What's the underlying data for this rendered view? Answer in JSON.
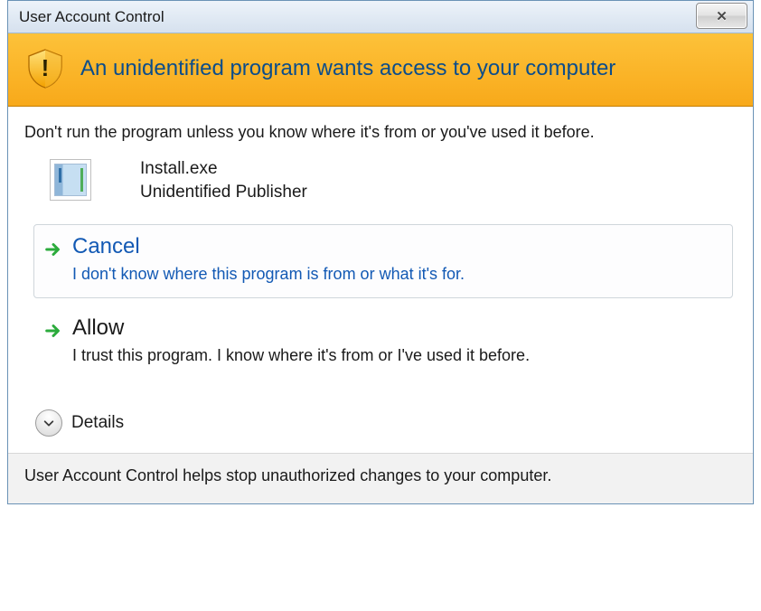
{
  "titlebar": {
    "title": "User Account Control"
  },
  "banner": {
    "heading": "An unidentified program wants access to your computer"
  },
  "instruction": "Don't run the program unless you know where it's from or you've used it before.",
  "program": {
    "filename": "Install.exe",
    "publisher": "Unidentified Publisher"
  },
  "options": {
    "cancel": {
      "title": "Cancel",
      "description": "I don't know where this program is from or what it's for."
    },
    "allow": {
      "title": "Allow",
      "description": "I trust this program. I know where it's from or I've used it before."
    }
  },
  "details": {
    "label": "Details"
  },
  "footer": {
    "text": "User Account Control helps stop unauthorized changes to your computer."
  }
}
